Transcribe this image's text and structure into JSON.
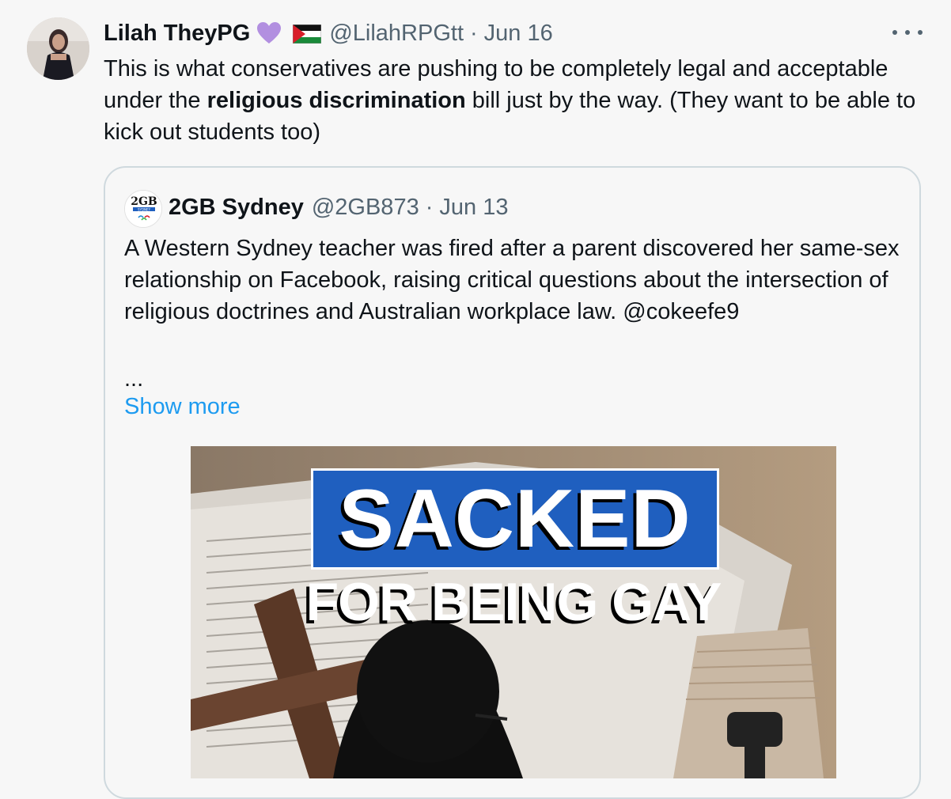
{
  "tweet": {
    "author_name": "Lilah TheyPG",
    "author_handle": "@LilahRPGtt",
    "separator": "·",
    "date": "Jun 16",
    "text_before": "This is what conservatives are pushing to be completely legal and acceptable under the ",
    "text_bold": "religious discrimination",
    "text_after": " bill just by the way. (They want to be able to kick out students too)",
    "heart_color": "#b28fe0",
    "icons": [
      "purple-heart-icon",
      "palestine-flag-icon",
      "more-options-icon"
    ]
  },
  "quote": {
    "author_name": "2GB Sydney",
    "author_handle": "@2GB873",
    "separator": "·",
    "date": "Jun 13",
    "avatar_text": "2GB",
    "avatar_subtext": "SYDNEY",
    "text": "A Western Sydney teacher was fired after a parent discovered her same-sex relationship on Facebook, raising critical questions about the intersection of religious doctrines and Australian workplace law. @cokeefe9",
    "ellipsis": "...",
    "show_more": "Show more",
    "link_color": "#1d9bf0",
    "media": {
      "headline": "SACKED",
      "subheadline": "FOR BEING GAY",
      "headline_bg": "#1f5fbf"
    }
  }
}
